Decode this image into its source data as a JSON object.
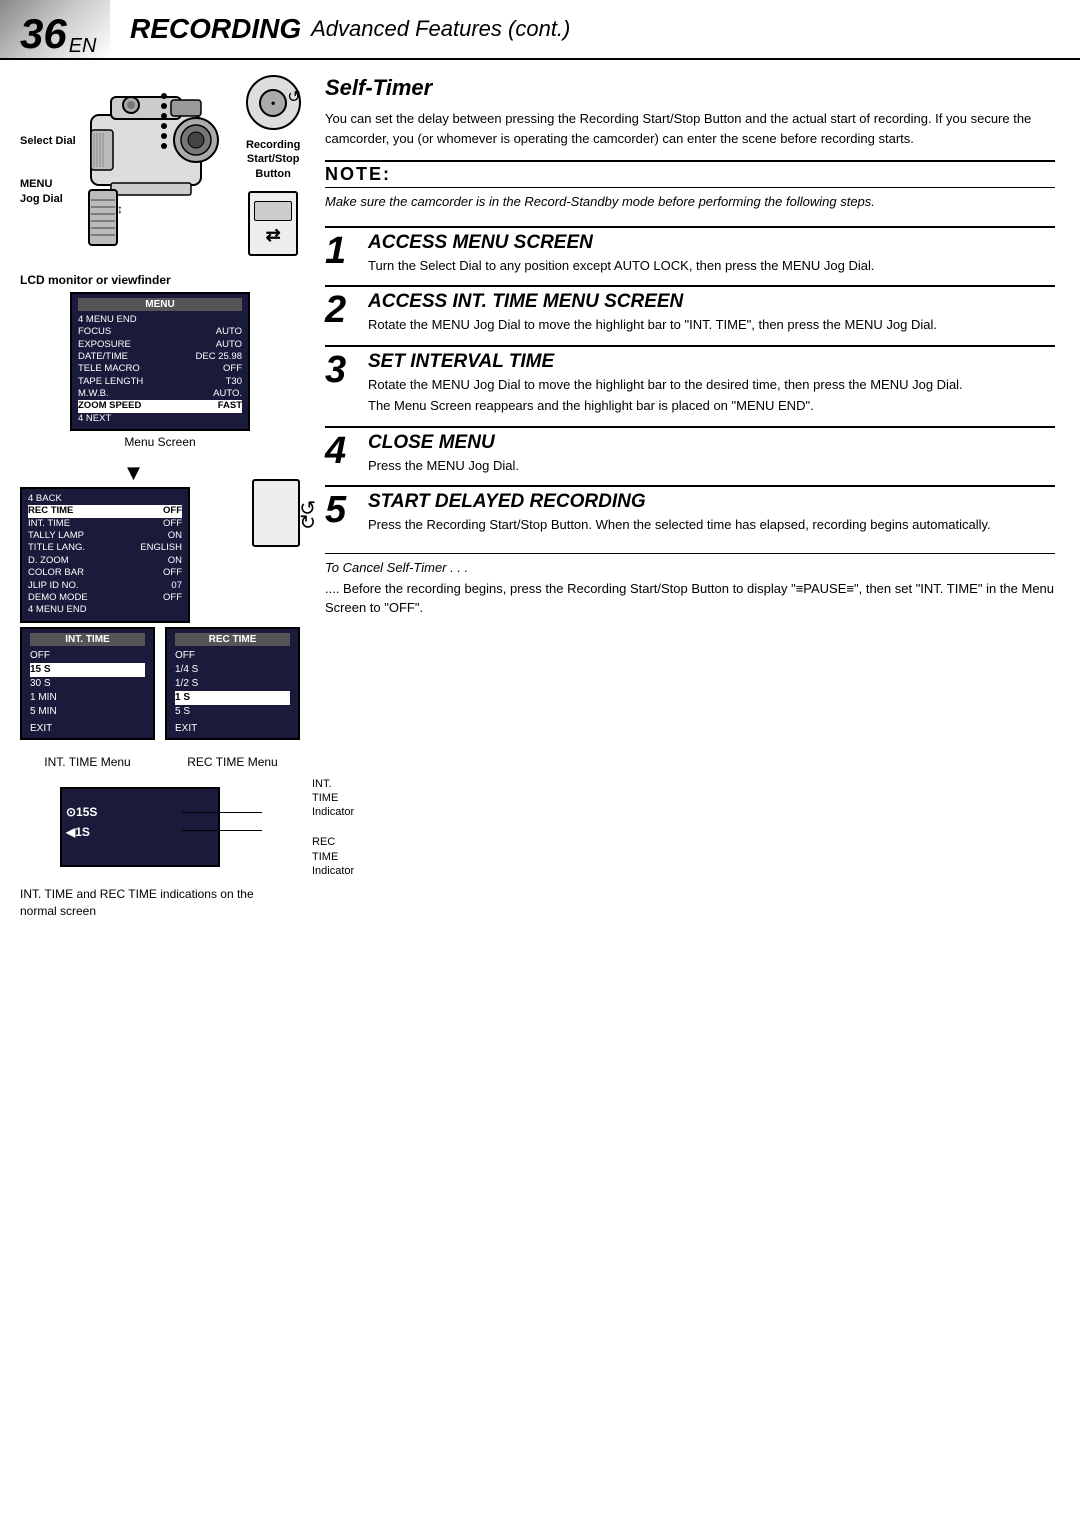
{
  "header": {
    "page_num": "36",
    "page_num_suffix": "EN",
    "title_recording": "RECORDING",
    "title_subtitle": "Advanced Features (cont.)"
  },
  "left_col": {
    "lcd_label": "LCD monitor or viewfinder",
    "select_dial_label": "Select Dial",
    "menu_jog_label": "MENU\nJog Dial",
    "rec_button_label": "Recording\nStart/Stop\nButton",
    "menu_screen_label": "Menu Screen",
    "menu1": {
      "title": "MENU",
      "rows": [
        {
          "left": "4 MENU END",
          "right": "",
          "highlight": false
        },
        {
          "left": "FOCUS",
          "right": "AUTO",
          "highlight": false
        },
        {
          "left": "EXPOSURE",
          "right": "AUTO",
          "highlight": false
        },
        {
          "left": "DATE/TIME",
          "right": "DEC 25.98",
          "highlight": false
        },
        {
          "left": "TELE MACRO",
          "right": "OFF",
          "highlight": false
        },
        {
          "left": "TAPE LENGTH",
          "right": "T30",
          "highlight": false
        },
        {
          "left": "M.W.B.",
          "right": "AUTO.",
          "highlight": false
        },
        {
          "left": "ZOOM SPEED",
          "right": "FAST",
          "highlight": true
        },
        {
          "left": "4 NEXT",
          "right": "",
          "highlight": false
        }
      ]
    },
    "menu2": {
      "title": "",
      "rows": [
        {
          "left": "4 BACK",
          "right": "",
          "highlight": false
        },
        {
          "left": "REC TIME",
          "right": "OFF",
          "highlight": true
        },
        {
          "left": "INT. TIME",
          "right": "OFF",
          "highlight": false
        },
        {
          "left": "TALLY LAMP",
          "right": "ON",
          "highlight": false
        },
        {
          "left": "TITLE LANG.",
          "right": "ENGLISH",
          "highlight": false
        },
        {
          "left": "D. ZOOM",
          "right": "ON",
          "highlight": false
        },
        {
          "left": "COLOR BAR",
          "right": "OFF",
          "highlight": false
        },
        {
          "left": "JLIP ID NO.",
          "right": "07",
          "highlight": false
        },
        {
          "left": "DEMO MODE",
          "right": "OFF",
          "highlight": false
        },
        {
          "left": "4 MENU END",
          "right": "",
          "highlight": false
        }
      ]
    },
    "int_time_box": {
      "title": "INT. TIME",
      "rows": [
        {
          "text": "OFF",
          "highlight": false
        },
        {
          "text": "15 S",
          "highlight": true
        },
        {
          "text": "30 S",
          "highlight": false
        },
        {
          "text": "1 MIN",
          "highlight": false
        },
        {
          "text": "5 MIN",
          "highlight": false
        }
      ],
      "exit": "EXIT"
    },
    "rec_time_box": {
      "title": "REC TIME",
      "rows": [
        {
          "text": "OFF",
          "highlight": false
        },
        {
          "text": "1/4 S",
          "highlight": false
        },
        {
          "text": "1/2 S",
          "highlight": false
        },
        {
          "text": "1 S",
          "highlight": true
        },
        {
          "text": "5 S",
          "highlight": false
        }
      ],
      "exit": "EXIT"
    },
    "int_time_label": "INT. TIME Menu",
    "rec_time_label": "REC TIME Menu",
    "normal_screen": {
      "int_time_value": "⊙15S",
      "rec_time_value": "◀1S"
    },
    "normal_screen_labels": {
      "int_time": "INT. TIME\nIndicator",
      "rec_time": "REC TIME\nIndicator"
    },
    "normal_screen_caption": "INT. TIME and REC TIME indications on the\nnormal screen"
  },
  "right_col": {
    "section_title": "Self-Timer",
    "intro_text": "You can set the delay between pressing the Recording Start/Stop Button and the actual start of recording. If you secure the camcorder, you (or whomever is operating the camcorder) can enter the scene before recording starts.",
    "note_title": "NOTE:",
    "note_text": "Make sure the camcorder is in the Record-Standby mode before performing the following steps.",
    "steps": [
      {
        "num": "1",
        "title": "ACCESS MENU SCREEN",
        "desc": "Turn the Select Dial to any position except AUTO LOCK, then press the MENU Jog Dial."
      },
      {
        "num": "2",
        "title": "ACCESS INT. TIME MENU SCREEN",
        "desc": "Rotate the MENU Jog Dial to move the highlight bar to \"INT. TIME\", then press the MENU Jog Dial."
      },
      {
        "num": "3",
        "title": "SET INTERVAL TIME",
        "desc": "Rotate the MENU Jog Dial to move the highlight bar to the desired time, then press the MENU Jog Dial.",
        "desc2": "The Menu Screen reappears and the highlight bar is placed on \"MENU END\"."
      },
      {
        "num": "4",
        "title": "CLOSE MENU",
        "desc": "Press the MENU Jog Dial."
      },
      {
        "num": "5",
        "title": "START DELAYED RECORDING",
        "desc": "Press the Recording Start/Stop Button. When the selected time has elapsed, recording begins automatically."
      }
    ],
    "cancel_section": {
      "title": "To Cancel Self-Timer . . .",
      "text1": ".... Before the recording begins, press the Recording Start/Stop Button to display \"≡PAUSE≡\", then set \"INT. TIME\" in the Menu Screen to \"OFF\"."
    }
  }
}
